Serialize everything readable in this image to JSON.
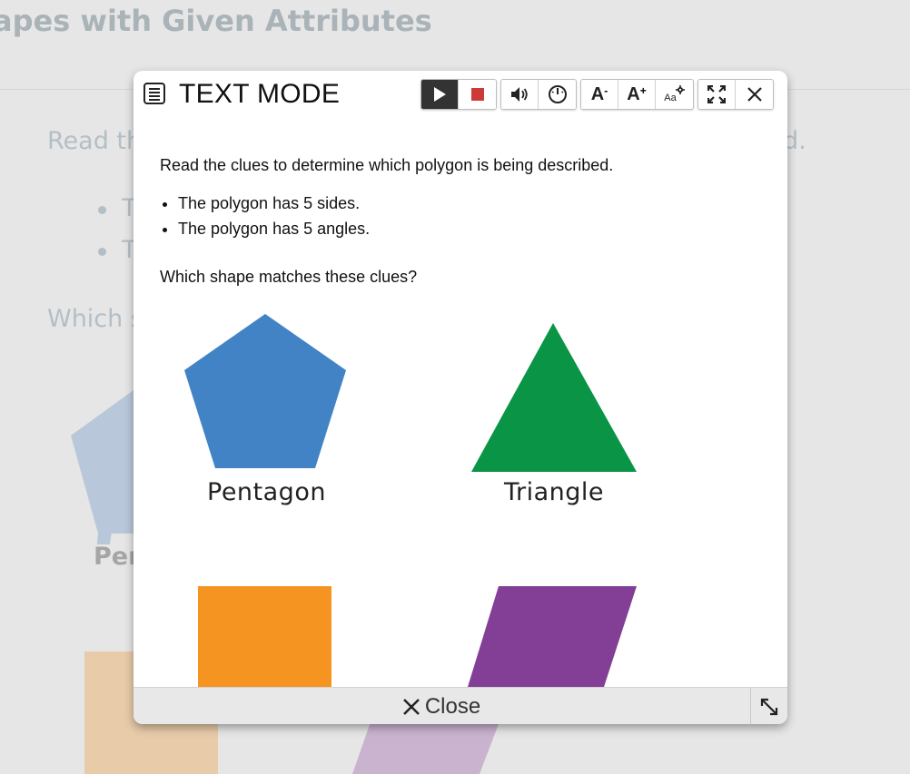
{
  "background": {
    "title": "apes with Given Attributes",
    "intro_fragment": "Read th",
    "intro_fragment_end": "d.",
    "bullet_1": "T",
    "bullet_2": "T",
    "question_fragment": "Which s",
    "shape_label_fragment": "Pen"
  },
  "modal": {
    "title": "TEXT MODE",
    "toolbar": {
      "play_icon": "play-icon",
      "stop_icon": "stop-icon",
      "volume_icon": "volume-icon",
      "speed_icon": "speed-gauge-icon",
      "decrease_font_label": "A",
      "decrease_font_sup": "-",
      "increase_font_label": "A",
      "increase_font_sup": "+",
      "font_settings_label": "Aa",
      "fullscreen_icon": "fullscreen-icon",
      "close_icon": "close-icon"
    },
    "prompt": "Read the clues to determine which polygon is being described.",
    "clues": [
      "The polygon has 5 sides.",
      "The polygon has 5 angles."
    ],
    "question": "Which shape matches these clues?",
    "options": [
      {
        "label": "Pentagon",
        "color": "#4283c5"
      },
      {
        "label": "Triangle",
        "color": "#0a9446"
      },
      {
        "label": "",
        "color": "#f59421"
      },
      {
        "label": "",
        "color": "#833e96"
      }
    ],
    "footer": {
      "close_label": "Close",
      "resize_icon": "resize-icon"
    }
  },
  "colors": {
    "stop_red": "#cc3b36",
    "bg_pentagon": "#b8c8da",
    "bg_orange": "#e8cba9",
    "bg_purple": "#c9b3cf"
  }
}
